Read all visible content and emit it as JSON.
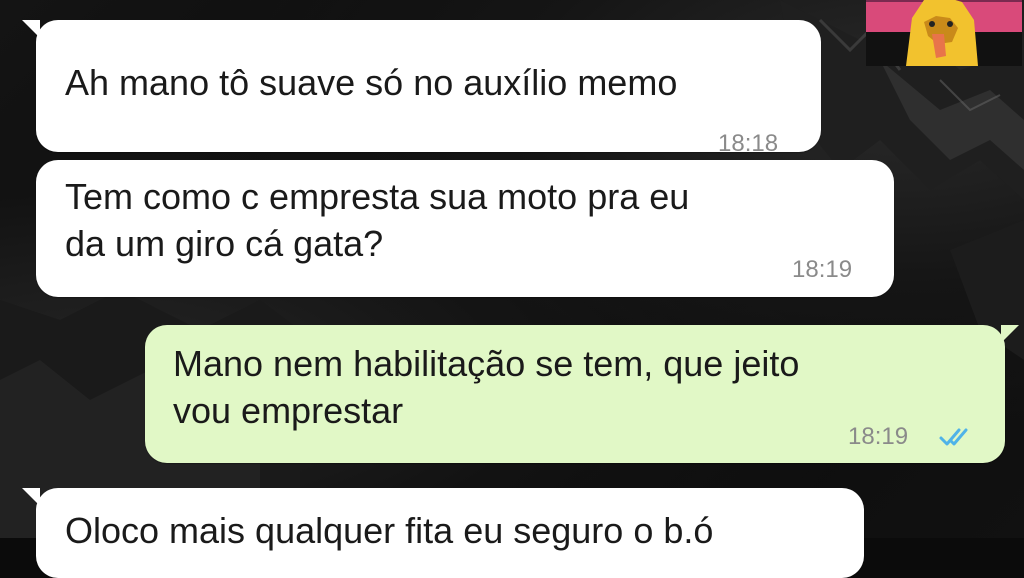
{
  "messages": [
    {
      "direction": "incoming",
      "lines": [
        "Ah mano tô suave só no auxílio memo"
      ],
      "time": "18:18"
    },
    {
      "direction": "incoming",
      "lines": [
        "Tem como c empresta sua moto pra eu",
        "da um giro cá gata?"
      ],
      "time": "18:19"
    },
    {
      "direction": "outgoing",
      "lines": [
        "Mano nem habilitação se tem, que jeito",
        "vou emprestar"
      ],
      "time": "18:19",
      "status": "read"
    },
    {
      "direction": "incoming",
      "lines": [
        "Oloco mais qualquer fita eu seguro o b.ó"
      ],
      "time": ""
    }
  ],
  "icons": {
    "read_receipt": "double-check-icon",
    "avatar": "profile-avatar"
  },
  "colors": {
    "incoming_bubble": "#ffffff",
    "outgoing_bubble": "#e1f8c6",
    "read_tick": "#4fb3e8",
    "timestamp": "#8a8a8a",
    "background": "#0b0b0b"
  }
}
